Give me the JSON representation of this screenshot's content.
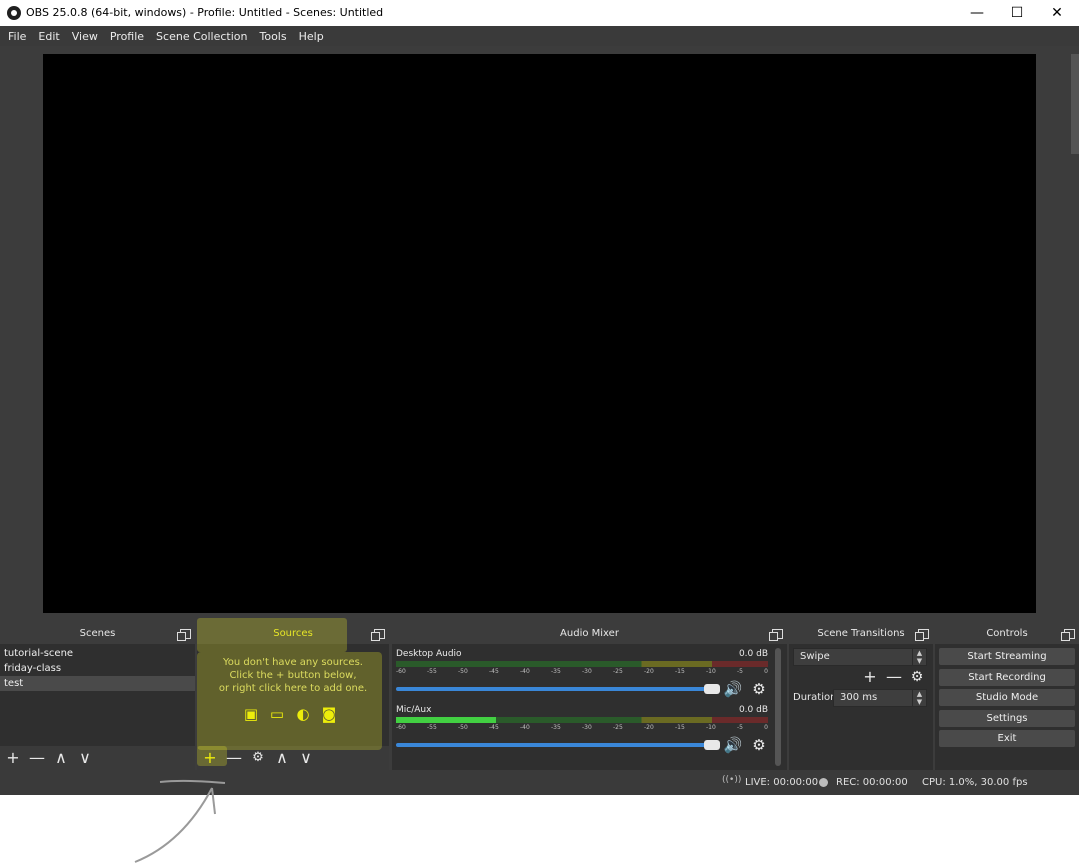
{
  "window": {
    "title": "OBS 25.0.8 (64-bit, windows) - Profile: Untitled - Scenes: Untitled",
    "minimize": "—",
    "maximize": "☐",
    "close": "✕"
  },
  "menu": [
    "File",
    "Edit",
    "View",
    "Profile",
    "Scene Collection",
    "Tools",
    "Help"
  ],
  "docks": {
    "scenes": {
      "title": "Scenes",
      "items": [
        "tutorial-scene",
        "friday-class",
        "test"
      ],
      "selected": "test"
    },
    "sources": {
      "title": "Sources",
      "empty_line1": "You don't have any sources.",
      "empty_line2": "Click the + button below,",
      "empty_line3": "or right click here to add one."
    },
    "mixer": {
      "title": "Audio Mixer",
      "ticks": [
        "-60",
        "-55",
        "-50",
        "-45",
        "-40",
        "-35",
        "-30",
        "-25",
        "-20",
        "-15",
        "-10",
        "-5",
        "0"
      ],
      "channels": [
        {
          "name": "Desktop Audio",
          "db": "0.0 dB",
          "level": 0.0,
          "volume": 1.0
        },
        {
          "name": "Mic/Aux",
          "db": "0.0 dB",
          "level": 0.27,
          "volume": 1.0
        }
      ]
    },
    "transitions": {
      "title": "Scene Transitions",
      "selected": "Swipe",
      "duration_label": "Duration",
      "duration_value": "300 ms"
    },
    "controls": {
      "title": "Controls",
      "buttons": [
        "Start Streaming",
        "Start Recording",
        "Studio Mode",
        "Settings",
        "Exit"
      ]
    }
  },
  "status": {
    "live": "LIVE: 00:00:00",
    "rec": "REC: 00:00:00",
    "cpu": "CPU: 1.0%, 30.00 fps"
  },
  "icons": {
    "plus": "+",
    "minus": "—",
    "up": "∧",
    "down": "∨",
    "gear": "⚙",
    "speaker": "🔊",
    "image": "▣",
    "monitor": "▭",
    "globe": "◐",
    "camera": "◙",
    "broadcast": "((•))"
  },
  "colors": {
    "highlight": "#e6e628",
    "accent": "#3a87d8",
    "meter_green": "#42d042"
  }
}
